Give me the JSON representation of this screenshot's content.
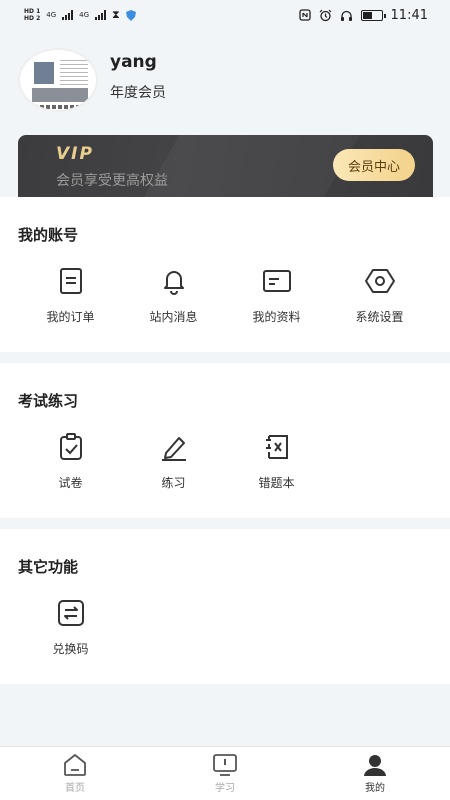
{
  "status_bar": {
    "hd1": "HD 1",
    "hd2": "HD 2",
    "net1": "4G",
    "net2": "4G",
    "time": "11:41"
  },
  "profile": {
    "username": "yang",
    "membership": "年度会员"
  },
  "vip": {
    "title": "VIP",
    "subtitle": "会员享受更高权益",
    "button": "会员中心"
  },
  "sections": {
    "account": {
      "title": "我的账号",
      "items": [
        {
          "label": "我的订单",
          "icon": "order-icon"
        },
        {
          "label": "站内消息",
          "icon": "bell-icon"
        },
        {
          "label": "我的资料",
          "icon": "profile-card-icon"
        },
        {
          "label": "系统设置",
          "icon": "settings-icon"
        }
      ]
    },
    "exam": {
      "title": "考试练习",
      "items": [
        {
          "label": "试卷",
          "icon": "clipboard-check-icon"
        },
        {
          "label": "练习",
          "icon": "pencil-icon"
        },
        {
          "label": "错题本",
          "icon": "wrong-book-icon"
        }
      ]
    },
    "other": {
      "title": "其它功能",
      "items": [
        {
          "label": "兑换码",
          "icon": "exchange-icon"
        }
      ]
    }
  },
  "tabbar": {
    "tabs": [
      {
        "label": "首页",
        "icon": "home-icon",
        "active": false
      },
      {
        "label": "学习",
        "icon": "study-icon",
        "active": false
      },
      {
        "label": "我的",
        "icon": "user-icon",
        "active": true
      }
    ]
  },
  "colors": {
    "background": "#f2f5f8",
    "vip_gold": "#e8cf8e",
    "vip_card": "#3c3c3e",
    "icon": "#333333"
  }
}
